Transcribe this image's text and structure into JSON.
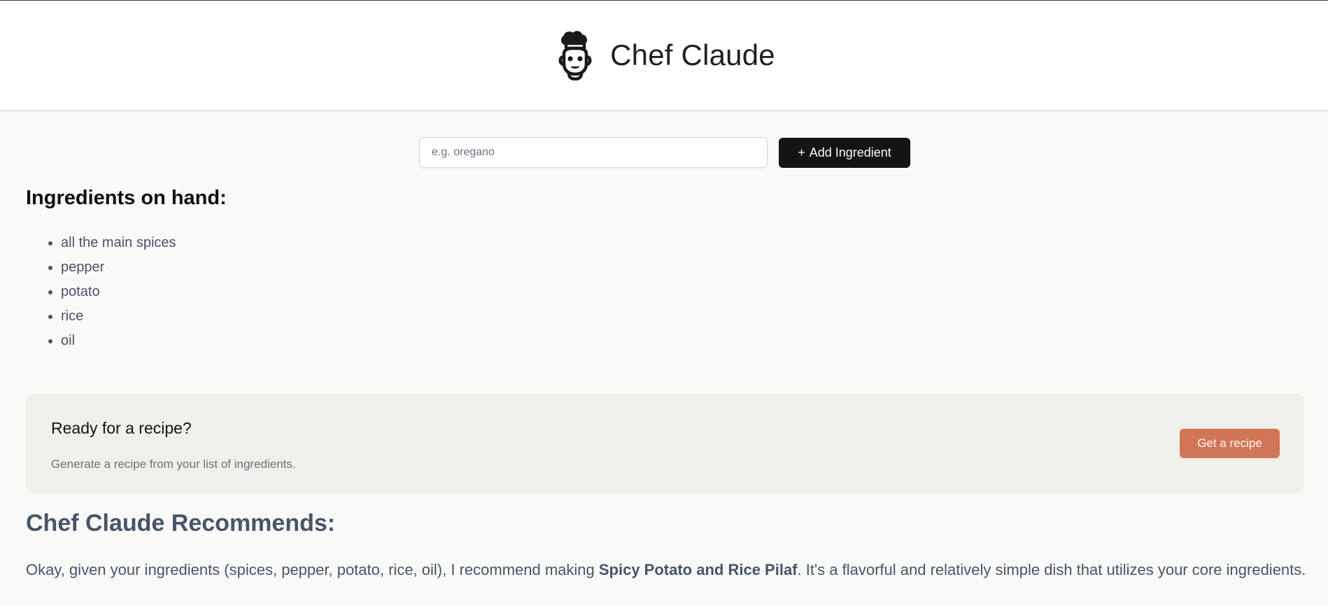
{
  "header": {
    "title": "Chef Claude",
    "logo_icon": "chef-hat-face-icon"
  },
  "ingredient_form": {
    "placeholder": "e.g. oregano",
    "value": "",
    "add_button_prefix": "+",
    "add_button_label": "Add Ingredient"
  },
  "ingredients": {
    "heading": "Ingredients on hand:",
    "items": [
      "all the main spices",
      "pepper",
      "potato",
      "rice",
      "oil"
    ]
  },
  "recipe_card": {
    "title": "Ready for a recipe?",
    "subtitle": "Generate a recipe from your list of ingredients.",
    "button_label": "Get a recipe"
  },
  "recommendation": {
    "heading": "Chef Claude Recommends:",
    "intro_before": "Okay, given your ingredients (spices, pepper, potato, rice, oil), I recommend making ",
    "dish_name": "Spicy Potato and Rice Pilaf",
    "intro_after": ". It's a flavorful and relatively simple dish that utilizes your core ingredients."
  },
  "colors": {
    "background": "#f9f9f7",
    "header_bg": "#ffffff",
    "dark_button": "#141413",
    "accent_button": "#d17557",
    "card_bg": "#f0efea",
    "muted_text": "#475569"
  }
}
